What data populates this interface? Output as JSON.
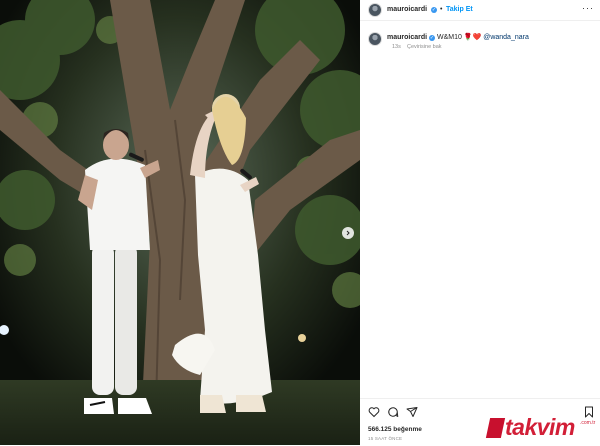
{
  "post": {
    "username": "mauroicardi",
    "follow_label": "Takip Et",
    "separator": "•",
    "more_label": "···"
  },
  "caption": {
    "username": "mauroicardi",
    "text": "W&M10 🌹❤️",
    "mention": "@wanda_nara",
    "age": "13s",
    "translate_label": "Çevirisine bak"
  },
  "footer": {
    "likes": "566.125 beğenme",
    "timestamp": "15 SAAT ÖNCE"
  },
  "watermark": {
    "brand": "takvim",
    "domain": ".com.tr"
  },
  "colors": {
    "verified_blue": "#3897f0",
    "link_blue": "#0095f6",
    "brand_red": "#d21f37"
  },
  "icons": [
    "heart-icon",
    "comment-icon",
    "share-icon",
    "bookmark-icon",
    "verified-icon",
    "chevron-right-icon",
    "more-icon"
  ]
}
